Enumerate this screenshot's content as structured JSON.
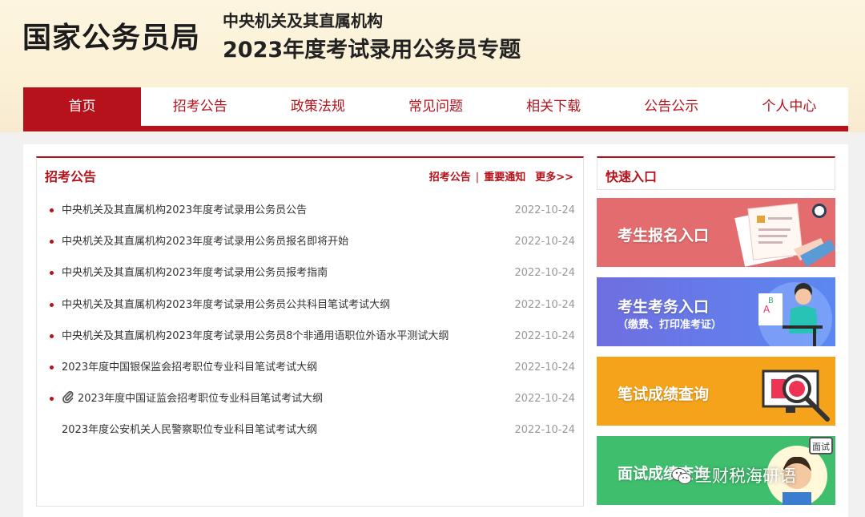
{
  "header": {
    "logo": "国家公务员局",
    "title_line1": "中央机关及其直属机构",
    "title_line2": "2023年度考试录用公务员专题"
  },
  "nav": [
    {
      "label": "首页",
      "active": true
    },
    {
      "label": "招考公告"
    },
    {
      "label": "政策法规"
    },
    {
      "label": "常见问题"
    },
    {
      "label": "相关下载"
    },
    {
      "label": "公告公示"
    },
    {
      "label": "个人中心"
    }
  ],
  "announcements": {
    "title": "招考公告",
    "link1": "招考公告",
    "separator": "|",
    "link2": "重要通知",
    "more": "更多>>",
    "items": [
      {
        "title": "中央机关及其直属机构2023年度考试录用公务员公告",
        "date": "2022-10-24",
        "dot": true
      },
      {
        "title": "中央机关及其直属机构2023年度考试录用公务员报名即将开始",
        "date": "2022-10-24",
        "dot": true
      },
      {
        "title": "中央机关及其直属机构2023年度考试录用公务员报考指南",
        "date": "2022-10-24",
        "dot": true
      },
      {
        "title": "中央机关及其直属机构2023年度考试录用公务员公共科目笔试考试大纲",
        "date": "2022-10-24",
        "dot": true
      },
      {
        "title": "中央机关及其直属机构2023年度考试录用公务员8个非通用语职位外语水平测试大纲",
        "date": "2022-10-24",
        "dot": true
      },
      {
        "title": "2023年度中国银保监会招考职位专业科目笔试考试大纲",
        "date": "2022-10-24",
        "dot": true
      },
      {
        "title": "2023年度中国证监会招考职位专业科目笔试考试大纲",
        "date": "2022-10-24",
        "dot": true,
        "icon": "paperclip-icon"
      },
      {
        "title": "2023年度公安机关人民警察职位专业科目笔试考试大纲",
        "date": "2022-10-24",
        "dot": false
      }
    ]
  },
  "quick": {
    "title": "快速入口",
    "cards": {
      "register": {
        "label": "考生报名入口"
      },
      "affairs": {
        "label": "考生考务入口",
        "sub": "（缴费、打印准考证）"
      },
      "written": {
        "label": "笔试成绩查询"
      },
      "interview": {
        "label": "面试成绩查询",
        "badge": "面试"
      }
    }
  },
  "watermark": {
    "text": "兰财税海研语",
    "icon": "wechat-icon"
  },
  "colors": {
    "brand_red": "#b5121b",
    "card1": "#e36d6e",
    "card2": "#6f6ee0",
    "card3": "#f5a31a",
    "card4": "#3fbf6d"
  }
}
